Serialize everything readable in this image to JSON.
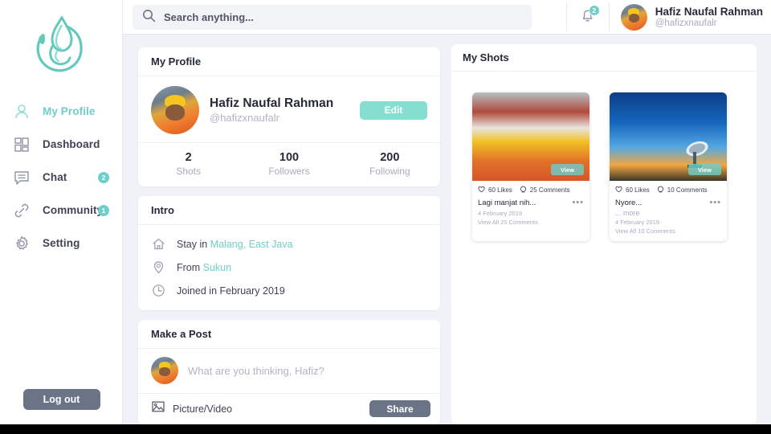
{
  "brand": {
    "logo_icon": "flame-circle-logo",
    "accent": "#6ececa",
    "slate": "#6b7486"
  },
  "sidebar": {
    "items": [
      {
        "label": "My Profile",
        "icon": "user-icon",
        "badge": null,
        "active": true
      },
      {
        "label": "Dashboard",
        "icon": "grid-icon",
        "badge": null,
        "active": false
      },
      {
        "label": "Chat",
        "icon": "chat-icon",
        "badge": "2",
        "active": false
      },
      {
        "label": "Community",
        "icon": "link-icon",
        "badge": "1",
        "active": false
      },
      {
        "label": "Setting",
        "icon": "gear-icon",
        "badge": null,
        "active": false
      }
    ],
    "logout_label": "Log out"
  },
  "header": {
    "search": {
      "icon": "search-icon",
      "placeholder": "Search anything...",
      "value": ""
    },
    "bell": {
      "icon": "bell-icon",
      "badge": "2"
    },
    "user": {
      "name": "Hafiz Naufal Rahman",
      "handle": "@hafizxnaufalr",
      "avatar": "user-avatar"
    }
  },
  "profile_card": {
    "title": "My Profile",
    "name": "Hafiz Naufal Rahman",
    "handle": "@hafizxnaufalr",
    "edit_label": "Edit",
    "stats": [
      {
        "num": "2",
        "label": "Shots"
      },
      {
        "num": "100",
        "label": "Followers"
      },
      {
        "num": "200",
        "label": "Following"
      }
    ]
  },
  "intro_card": {
    "title": "Intro",
    "rows": [
      {
        "icon": "home-icon",
        "text": "Stay in ",
        "link": "Malang, East Java"
      },
      {
        "icon": "pin-icon",
        "text": "From ",
        "link": "Sukun"
      },
      {
        "icon": "clock-icon",
        "text": "Joined in February 2019",
        "link": ""
      }
    ]
  },
  "post_card": {
    "title": "Make a Post",
    "placeholder": "What are you thinking, Hafiz?",
    "value": "",
    "picture_video_label": "Picture/Video",
    "picture_video_icon": "image-icon",
    "share_label": "Share"
  },
  "shots_panel": {
    "title": "My Shots",
    "shots": [
      {
        "image": "construction-photo",
        "view_label": "View",
        "likes": "60 Likes",
        "comments": "25 Comments",
        "caption": "Lagi manjat nih...",
        "more": "",
        "date": "4 February 2019",
        "view_all": "View All 25 Comments",
        "menu_icon": "more-dots-icon",
        "like_icon": "heart-icon",
        "comment_icon": "comment-icon"
      },
      {
        "image": "satellite-dish-sunset-photo",
        "view_label": "View",
        "likes": "60 Likes",
        "comments": "10 Comments",
        "caption": "Nyore...",
        "more": "... more",
        "date": "4 February 2019",
        "view_all": "View All 10 Comments",
        "menu_icon": "more-dots-icon",
        "like_icon": "heart-icon",
        "comment_icon": "comment-icon"
      }
    ]
  }
}
